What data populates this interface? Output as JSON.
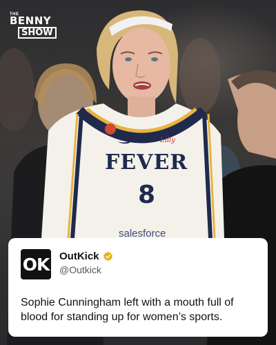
{
  "brand": {
    "logo_small": "THE",
    "logo_line1": "BENNY",
    "logo_line2": "SHOW"
  },
  "photo": {
    "jersey_team": "FEVER",
    "jersey_number": "8",
    "jersey_sponsor": "salesforce",
    "jersey_patch": "Lilly"
  },
  "post": {
    "avatar_text": "OK",
    "name": "OutKick",
    "handle": "@Outkick",
    "verified_color": "#E8B10D",
    "text": "Sophie Cunningham left with a mouth full of blood for standing up for women’s sports."
  }
}
